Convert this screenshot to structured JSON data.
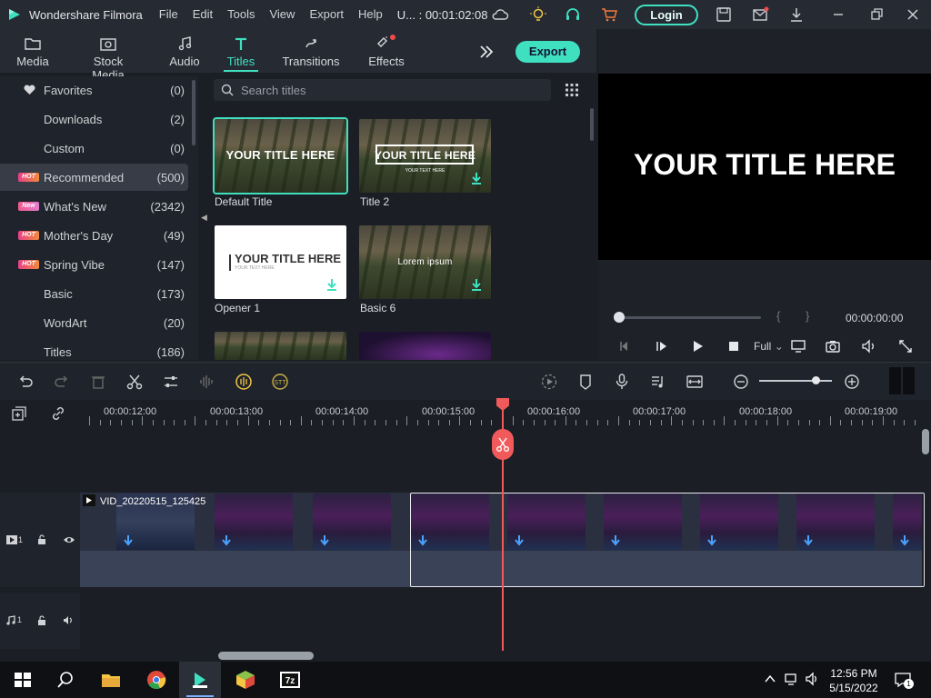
{
  "app": {
    "name": "Wondershare Filmora",
    "menu": [
      "File",
      "Edit",
      "Tools",
      "View",
      "Export",
      "Help"
    ],
    "project": "U... : 00:01:02:08",
    "login_label": "Login"
  },
  "media_tabs": [
    {
      "label": "Media",
      "icon": "folder-icon"
    },
    {
      "label": "Stock Media",
      "icon": "stock-media-icon"
    },
    {
      "label": "Audio",
      "icon": "music-note-icon"
    },
    {
      "label": "Titles",
      "icon": "text-t-icon",
      "active": true
    },
    {
      "label": "Transitions",
      "icon": "transitions-icon"
    },
    {
      "label": "Effects",
      "icon": "effects-icon"
    }
  ],
  "export_label": "Export",
  "sidebar": {
    "items": [
      {
        "label": "Favorites",
        "count": "(0)",
        "icon": "heart-icon"
      },
      {
        "label": "Downloads",
        "count": "(2)"
      },
      {
        "label": "Custom",
        "count": "(0)"
      },
      {
        "label": "Recommended",
        "count": "(500)",
        "badge": "HOT",
        "active": true
      },
      {
        "label": "What's New",
        "count": "(2342)",
        "badge": "New"
      },
      {
        "label": "Mother's Day",
        "count": "(49)",
        "badge": "HOT"
      },
      {
        "label": "Spring Vibe",
        "count": "(147)",
        "badge": "HOT"
      },
      {
        "label": "Basic",
        "count": "(173)"
      },
      {
        "label": "WordArt",
        "count": "(20)"
      },
      {
        "label": "Titles",
        "count": "(186)"
      }
    ]
  },
  "search": {
    "placeholder": "Search titles"
  },
  "titles": [
    {
      "name": "Default Title",
      "caption": "YOUR TITLE HERE"
    },
    {
      "name": "Title 2",
      "caption": "YOUR TITLE HERE",
      "sub": "YOUR TEXT HERE"
    },
    {
      "name": "Opener 1",
      "caption": "YOUR TITLE HERE",
      "sub": "YOUR TEXT HERE"
    },
    {
      "name": "Basic 6",
      "caption": "Lorem ipsum"
    }
  ],
  "preview": {
    "title": "YOUR TITLE HERE",
    "timecode": "00:00:00:00",
    "quality": "Full",
    "brace_open": "{",
    "brace_close": "}"
  },
  "ruler": [
    "00:00:12:00",
    "00:00:13:00",
    "00:00:14:00",
    "00:00:15:00",
    "00:00:16:00",
    "00:00:17:00",
    "00:00:18:00",
    "00:00:19:00"
  ],
  "tracks": {
    "video_label": "1",
    "audio_label": "1",
    "clip_name": "VID_20220515_125425"
  },
  "taskbar": {
    "time": "12:56 PM",
    "date": "5/15/2022",
    "notifications": "1"
  }
}
